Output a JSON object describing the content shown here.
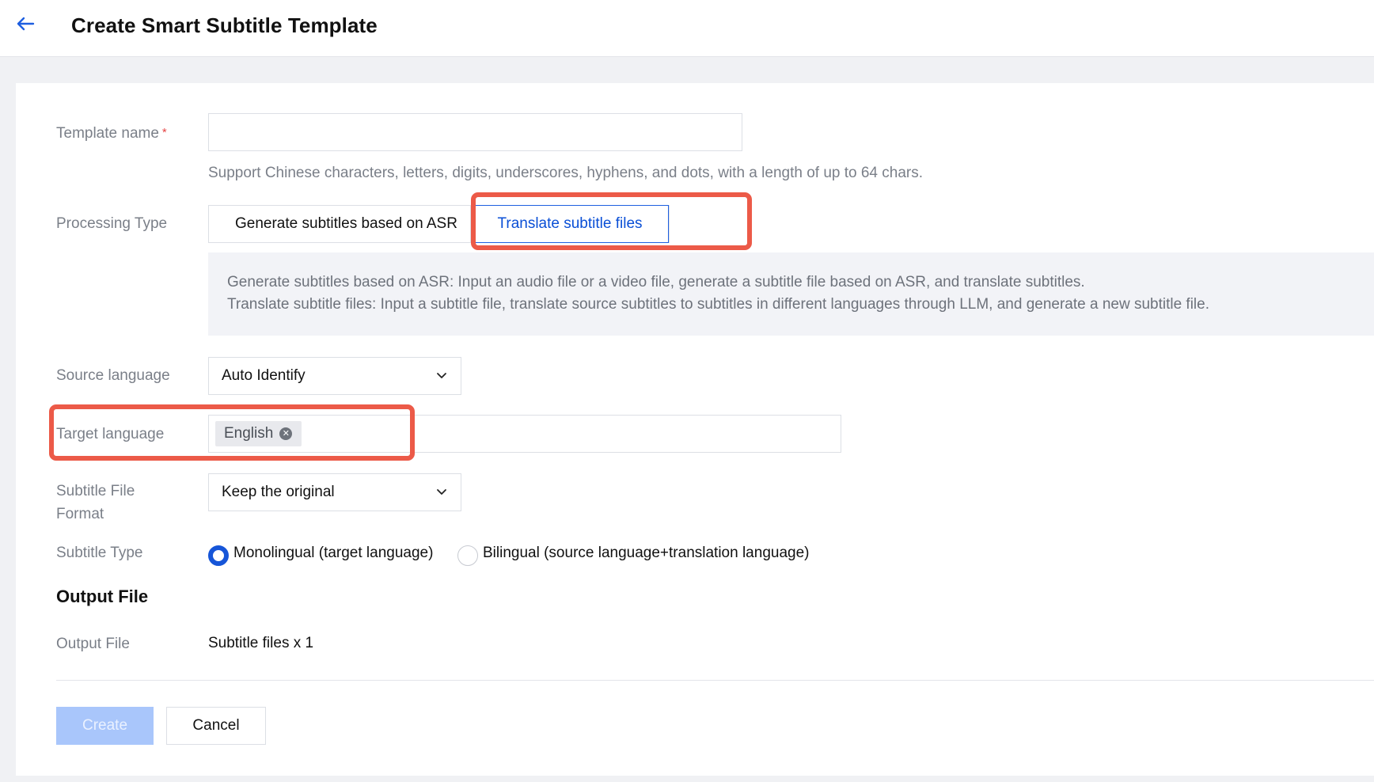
{
  "header": {
    "back_icon": "arrow-left-icon",
    "title": "Create Smart Subtitle Template"
  },
  "form": {
    "template_name": {
      "label": "Template name",
      "required_mark": "*",
      "value": "",
      "hint": "Support Chinese characters, letters, digits, underscores, hyphens, and dots, with a length of up to 64 chars."
    },
    "processing_type": {
      "label": "Processing Type",
      "options": [
        "Generate subtitles based on ASR",
        "Translate subtitle files"
      ],
      "selected": "Translate subtitle files",
      "info": [
        "Generate subtitles based on ASR: Input an audio file or a video file, generate a subtitle file based on ASR, and translate subtitles.",
        "Translate subtitle files: Input a subtitle file, translate source subtitles to subtitles in different languages through LLM, and generate a new subtitle file."
      ]
    },
    "source_language": {
      "label": "Source language",
      "value": "Auto Identify"
    },
    "target_language": {
      "label": "Target language",
      "tags": [
        "English"
      ]
    },
    "subtitle_file_format": {
      "label_line1": "Subtitle File",
      "label_line2": "Format",
      "value": "Keep the original"
    },
    "subtitle_type": {
      "label": "Subtitle Type",
      "options": [
        "Monolingual (target language)",
        "Bilingual (source language+translation language)"
      ],
      "selected": "Monolingual (target language)"
    }
  },
  "output": {
    "section_title": "Output File",
    "label": "Output File",
    "value": "Subtitle files x 1"
  },
  "actions": {
    "create_label": "Create",
    "cancel_label": "Cancel"
  },
  "colors": {
    "accent": "#1655d8",
    "highlight": "#ec5a48",
    "create_disabled": "#a9c6fb"
  }
}
